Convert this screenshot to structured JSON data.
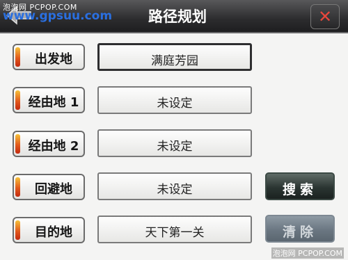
{
  "watermark": {
    "top_small": "泡泡网 PCPOP.COM",
    "top_large": "www.gpsuu.com",
    "bottom": "泡泡网 PCPOP.COM"
  },
  "header": {
    "title": "路径规划",
    "back_icon": "back-arrow-icon",
    "close_icon": "close-icon",
    "close_glyph": "✕"
  },
  "route_fields": [
    {
      "label": "出发地",
      "value": "满庭芳园"
    },
    {
      "label": "经由地 1",
      "value": "未设定"
    },
    {
      "label": "经由地 2",
      "value": "未设定"
    },
    {
      "label": "回避地",
      "value": "未设定"
    },
    {
      "label": "目的地",
      "value": "天下第一关"
    }
  ],
  "actions": {
    "search_label": "搜索",
    "clear_label": "清除"
  },
  "colors": {
    "accent_stripe": "#e25a1c",
    "close_x": "#e8473c",
    "title_bar": "#2c2c2e"
  }
}
